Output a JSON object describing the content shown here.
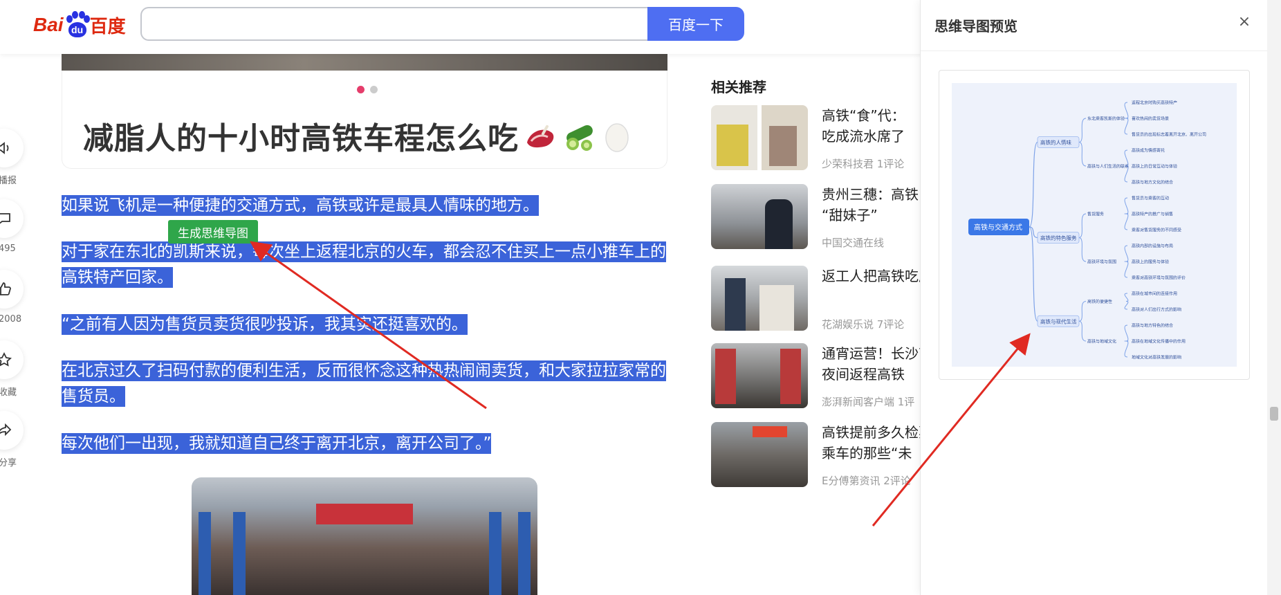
{
  "header": {
    "logo_bai": "Bai",
    "logo_du": "du",
    "logo_baidu": "百度",
    "search_placeholder": "",
    "search_button": "百度一下"
  },
  "rail": [
    {
      "icon": "speaker-icon",
      "label": "播报"
    },
    {
      "icon": "comment-icon",
      "label": "495"
    },
    {
      "icon": "like-icon",
      "label": "2008"
    },
    {
      "icon": "star-icon",
      "label": "收藏"
    },
    {
      "icon": "share-icon",
      "label": "分享"
    }
  ],
  "article": {
    "card_title": "减脂人的十小时高铁车程怎么吃",
    "paragraphs": [
      "如果说飞机是一种便捷的交通方式，高铁或许是最具人情味的地方。",
      "对于家在东北的凯斯来说，每次坐上返程北京的火车，都会忍不住买上一点小推车上的高铁特产回家。",
      "“之前有人因为售货员卖货很吵投诉，我其实还挺喜欢的。",
      "在北京过久了扫码付款的便利生活，反而很怀念这种热热闹闹卖货，和大家拉拉家常的售货员。",
      "每次他们一出现，我就知道自己终于离开北京，离开公司了。”"
    ],
    "mindmap_button": "生成思维导图"
  },
  "related": {
    "title": "相关推荐",
    "items": [
      {
        "text1": "高铁“食”代：",
        "text2": "吃成流水席了",
        "meta": "少荣科技君   1评论"
      },
      {
        "text1": "贵州三穗：高铁",
        "text2": "“甜妹子”",
        "meta": "中国交通在线"
      },
      {
        "text1": "返工人把高铁吃成",
        "text2": "",
        "meta": "花湖娱乐说   7评论"
      },
      {
        "text1": "通宵运营！长沙南",
        "text2": "夜间返程高铁",
        "meta": "澎湃新闻客户端   1评"
      },
      {
        "text1": "高铁提前多久检票",
        "text2": "乘车的那些“未",
        "meta": "E分傅第资讯   2评论"
      }
    ]
  },
  "panel": {
    "title": "思维导图预览",
    "close": "×",
    "mindmap": {
      "root": "高铁与交通方式",
      "branches": [
        {
          "label": "高铁的人情味",
          "subs": [
            {
              "label": "东北乘客凯斯的体验",
              "leaves": [
                "返程北京时购买高铁特产",
                "喜欢热闹的卖货场景",
                "售货员的出现标志着离开北京、离开公司"
              ]
            },
            {
              "label": "高铁与人们生活的联系",
              "leaves": [
                "高铁成为情感寄托",
                "高铁上的日常互动与体验",
                "高铁与地方文化的结合"
              ]
            }
          ]
        },
        {
          "label": "高铁的特色服务",
          "subs": [
            {
              "label": "售货服务",
              "leaves": [
                "售货员与乘客的互动",
                "高铁特产的推广与销售",
                "乘客对售货服务的不同感受"
              ]
            },
            {
              "label": "高铁环境与氛围",
              "leaves": [
                "高铁内部的设施与布局",
                "高铁上的服务与体验",
                "乘客对高铁环境与氛围的评价"
              ]
            }
          ]
        },
        {
          "label": "高铁与现代生活",
          "subs": [
            {
              "label": "高铁的便捷性",
              "leaves": [
                "高铁在城市间的连接作用",
                "高铁对人们出行方式的影响"
              ]
            },
            {
              "label": "高铁与地域文化",
              "leaves": [
                "高铁与地方特色的结合",
                "高铁在地域文化传播中的作用",
                "地域文化对高铁发展的影响"
              ]
            }
          ]
        }
      ]
    }
  },
  "colors": {
    "accent": "#4e6ef2",
    "highlight": "#3b63d9",
    "mindmap_button": "#2fa64a",
    "arrow": "#e02a22",
    "mindmap_node": "#3b78e7"
  }
}
